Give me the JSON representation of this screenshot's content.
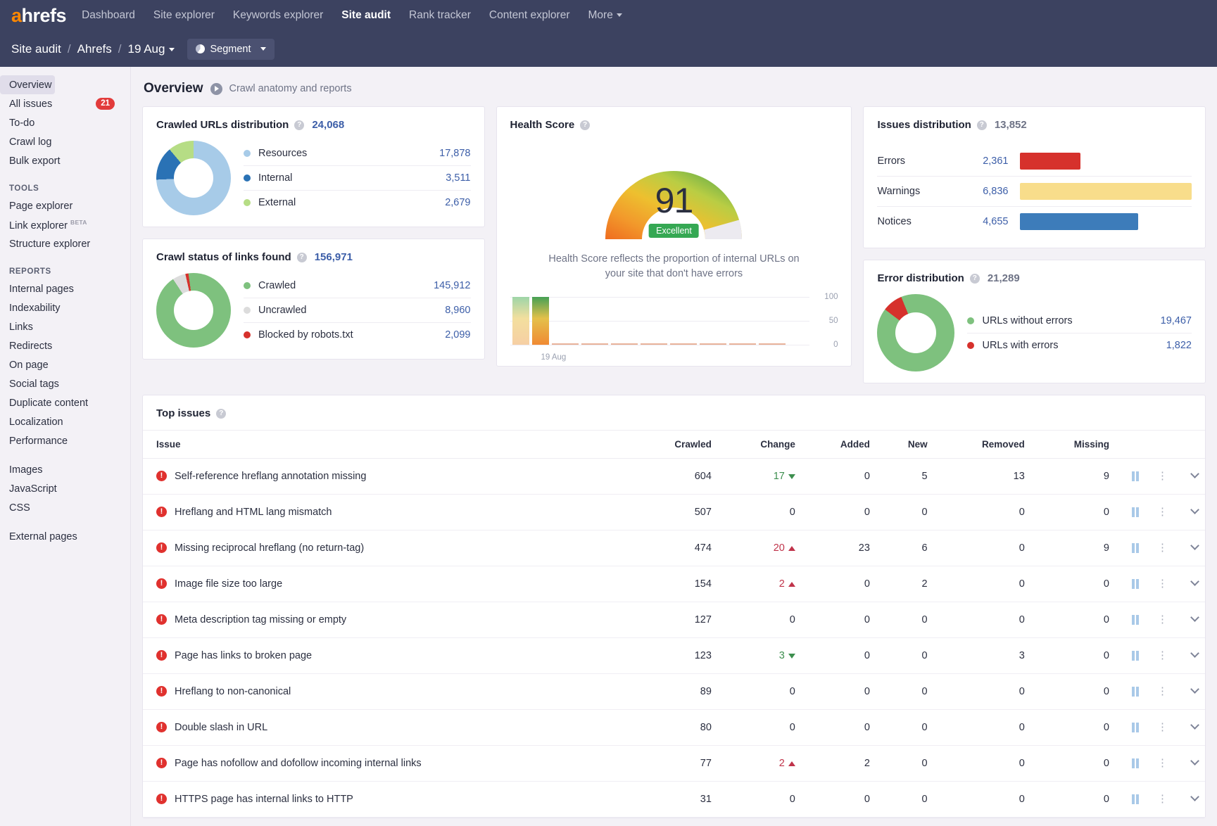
{
  "brand": {
    "logo_a": "a",
    "logo_rest": "hrefs"
  },
  "topnav": {
    "items": [
      {
        "label": "Dashboard",
        "active": false
      },
      {
        "label": "Site explorer",
        "active": false
      },
      {
        "label": "Keywords explorer",
        "active": false
      },
      {
        "label": "Site audit",
        "active": true
      },
      {
        "label": "Rank tracker",
        "active": false
      },
      {
        "label": "Content explorer",
        "active": false
      },
      {
        "label": "More",
        "active": false
      }
    ]
  },
  "breadcrumb": {
    "project": "Site audit",
    "sep": "/",
    "site": "Ahrefs",
    "date": "19 Aug",
    "segment_label": "Segment"
  },
  "sidebar": {
    "items": [
      {
        "label": "Overview",
        "badge": null,
        "active": true
      },
      {
        "label": "All issues",
        "badge": "21",
        "active": false
      },
      {
        "label": "To-do",
        "badge": null,
        "active": false
      },
      {
        "label": "Crawl log",
        "badge": null,
        "active": false
      },
      {
        "label": "Bulk export",
        "badge": null,
        "active": false
      }
    ],
    "tools_heading": "TOOLS",
    "tools": [
      {
        "label": "Page explorer",
        "beta": null
      },
      {
        "label": "Link explorer",
        "beta": "BETA"
      },
      {
        "label": "Structure explorer",
        "beta": null
      }
    ],
    "reports_heading": "REPORTS",
    "reports": [
      {
        "label": "Internal pages"
      },
      {
        "label": "Indexability"
      },
      {
        "label": "Links"
      },
      {
        "label": "Redirects"
      },
      {
        "label": "On page"
      },
      {
        "label": "Social tags"
      },
      {
        "label": "Duplicate content"
      },
      {
        "label": "Localization"
      },
      {
        "label": "Performance"
      }
    ],
    "assets": [
      {
        "label": "Images"
      },
      {
        "label": "JavaScript"
      },
      {
        "label": "CSS"
      }
    ],
    "external": [
      {
        "label": "External pages"
      }
    ]
  },
  "page": {
    "title": "Overview",
    "subtitle": "Crawl anatomy and reports"
  },
  "crawled_urls": {
    "title": "Crawled URLs distribution",
    "total": "24,068",
    "legend": [
      {
        "label": "Resources",
        "value": "17,878",
        "color": "#a7cbe8"
      },
      {
        "label": "Internal",
        "value": "3,511",
        "color": "#2a72b5"
      },
      {
        "label": "External",
        "value": "2,679",
        "color": "#b6dd85"
      }
    ]
  },
  "crawl_status": {
    "title": "Crawl status of links found",
    "total": "156,971",
    "legend": [
      {
        "label": "Crawled",
        "value": "145,912",
        "color": "#7ec17e"
      },
      {
        "label": "Uncrawled",
        "value": "8,960",
        "color": "#dcdcdc"
      },
      {
        "label": "Blocked by robots.txt",
        "value": "2,099",
        "color": "#d6312c"
      }
    ]
  },
  "health_score": {
    "title": "Health Score",
    "score": "91",
    "rating": "Excellent",
    "description": "Health Score reflects the proportion of internal URLs on your site that don't have errors"
  },
  "issues_distribution": {
    "title": "Issues distribution",
    "total": "13,852",
    "rows": [
      {
        "label": "Errors",
        "value": "2,361",
        "color": "#d6312c",
        "pct": 35
      },
      {
        "label": "Warnings",
        "value": "6,836",
        "color": "#f8dd8b",
        "pct": 100
      },
      {
        "label": "Notices",
        "value": "4,655",
        "color": "#3d7cba",
        "pct": 69
      }
    ]
  },
  "error_distribution": {
    "title": "Error distribution",
    "total": "21,289",
    "legend": [
      {
        "label": "URLs without errors",
        "value": "19,467",
        "color": "#7ec17e"
      },
      {
        "label": "URLs with errors",
        "value": "1,822",
        "color": "#d6312c"
      }
    ]
  },
  "chart_data": [
    {
      "type": "pie",
      "title": "Crawled URLs distribution",
      "total": 24068,
      "labels": [
        "Resources",
        "Internal",
        "External"
      ],
      "values": [
        17878,
        3511,
        2679
      ],
      "colors": [
        "#a7cbe8",
        "#2a72b5",
        "#b6dd85"
      ],
      "legend": "right"
    },
    {
      "type": "pie",
      "title": "Crawl status of links found",
      "total": 156971,
      "labels": [
        "Crawled",
        "Uncrawled",
        "Blocked by robots.txt"
      ],
      "values": [
        145912,
        8960,
        2099
      ],
      "colors": [
        "#7ec17e",
        "#dcdcdc",
        "#d6312c"
      ],
      "legend": "right"
    },
    {
      "type": "bar",
      "title": "Issues distribution",
      "total": 13852,
      "categories": [
        "Errors",
        "Warnings",
        "Notices"
      ],
      "values": [
        2361,
        6836,
        4655
      ],
      "colors": [
        "#d6312c",
        "#f8dd8b",
        "#3d7cba"
      ],
      "orientation": "horizontal",
      "xlim": [
        0,
        6836
      ]
    },
    {
      "type": "pie",
      "title": "Error distribution",
      "total": 21289,
      "labels": [
        "URLs without errors",
        "URLs with errors"
      ],
      "values": [
        19467,
        1822
      ],
      "colors": [
        "#7ec17e",
        "#d6312c"
      ],
      "legend": "right"
    },
    {
      "type": "bar",
      "title": "Health Score history",
      "categories": [
        "19 Aug",
        "19 Aug",
        "",
        "",
        "",
        "",
        "",
        "",
        "",
        "",
        "",
        ""
      ],
      "values": [
        91,
        91,
        0,
        0,
        0,
        0,
        0,
        0,
        0,
        0,
        0,
        0
      ],
      "ylabel": "",
      "ylim": [
        0,
        100
      ],
      "yticks": [
        0,
        50,
        100
      ],
      "xlabel_visible": "19 Aug",
      "grid": true
    }
  ],
  "top_issues": {
    "title": "Top issues",
    "columns": [
      "Issue",
      "Crawled",
      "Change",
      "Added",
      "New",
      "Removed",
      "Missing"
    ],
    "rows": [
      {
        "issue": "Self-reference hreflang annotation missing",
        "crawled": "604",
        "change": "17",
        "change_dir": "down",
        "added": "0",
        "new": "5",
        "removed": "13",
        "missing": "9"
      },
      {
        "issue": "Hreflang and HTML lang mismatch",
        "crawled": "507",
        "change": "0",
        "change_dir": "none",
        "added": "0",
        "new": "0",
        "removed": "0",
        "missing": "0"
      },
      {
        "issue": "Missing reciprocal hreflang (no return-tag)",
        "crawled": "474",
        "change": "20",
        "change_dir": "up",
        "added": "23",
        "new": "6",
        "removed": "0",
        "missing": "9"
      },
      {
        "issue": "Image file size too large",
        "crawled": "154",
        "change": "2",
        "change_dir": "up",
        "added": "0",
        "new": "2",
        "removed": "0",
        "missing": "0"
      },
      {
        "issue": "Meta description tag missing or empty",
        "crawled": "127",
        "change": "0",
        "change_dir": "none",
        "added": "0",
        "new": "0",
        "removed": "0",
        "missing": "0"
      },
      {
        "issue": "Page has links to broken page",
        "crawled": "123",
        "change": "3",
        "change_dir": "down",
        "added": "0",
        "new": "0",
        "removed": "3",
        "missing": "0"
      },
      {
        "issue": "Hreflang to non-canonical",
        "crawled": "89",
        "change": "0",
        "change_dir": "none",
        "added": "0",
        "new": "0",
        "removed": "0",
        "missing": "0"
      },
      {
        "issue": "Double slash in URL",
        "crawled": "80",
        "change": "0",
        "change_dir": "none",
        "added": "0",
        "new": "0",
        "removed": "0",
        "missing": "0"
      },
      {
        "issue": "Page has nofollow and dofollow incoming internal links",
        "crawled": "77",
        "change": "2",
        "change_dir": "up",
        "added": "2",
        "new": "0",
        "removed": "0",
        "missing": "0"
      },
      {
        "issue": "HTTPS page has internal links to HTTP",
        "crawled": "31",
        "change": "0",
        "change_dir": "none",
        "added": "0",
        "new": "0",
        "removed": "0",
        "missing": "0"
      }
    ]
  },
  "icons": {
    "help": "?",
    "error": "!",
    "kebab": "⋮"
  }
}
